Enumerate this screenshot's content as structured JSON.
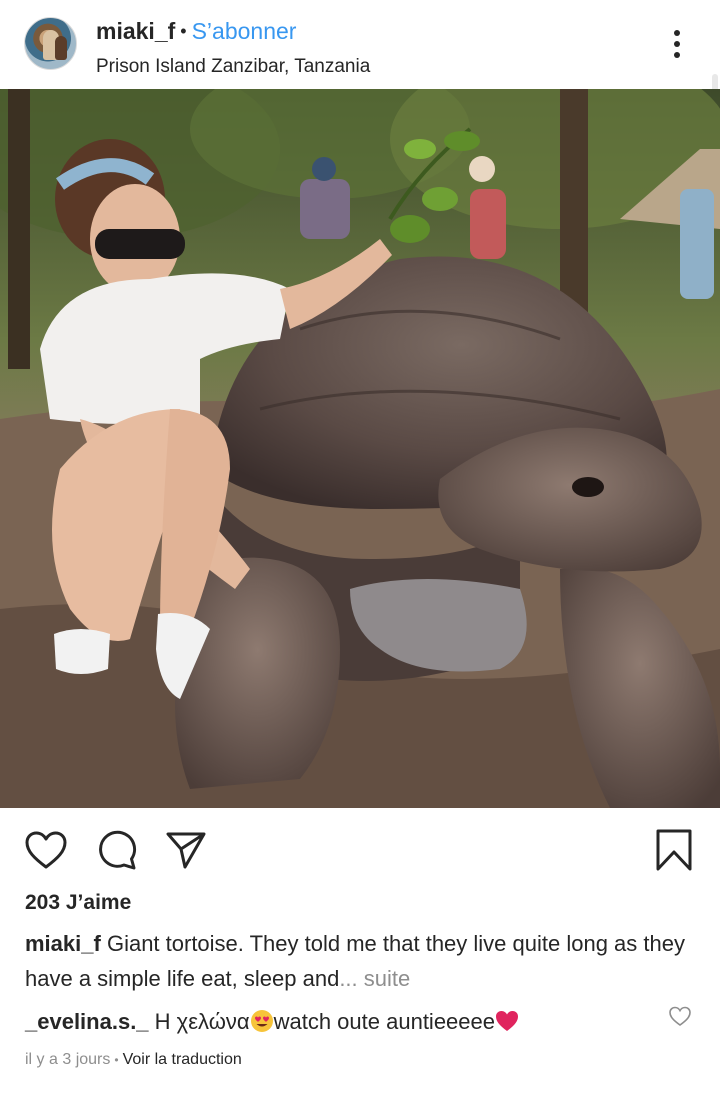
{
  "post": {
    "username": "miaki_f",
    "separator": "•",
    "follow_label": "S’abonner",
    "location": "Prison Island Zanzibar, Tanzania",
    "more_icon": "more-vertical-icon"
  },
  "actions": {
    "like_icon": "heart-outline-icon",
    "comment_icon": "comment-bubble-icon",
    "share_icon": "send-icon",
    "save_icon": "bookmark-icon"
  },
  "likes": "203 J’aime",
  "caption": {
    "username": "miaki_f",
    "text": "Giant tortoise. They told me that they live quite long as they have a simple life eat, sleep and",
    "ellipsis": "...",
    "more_label": "suite"
  },
  "comment": {
    "username": "_evelina.s._",
    "text_before_emoji": "Η χελώνα",
    "text_after_emoji": "watch oute auntieeeee",
    "emoji_1": "heart-eyes-emoji",
    "emoji_2": "red-heart-emoji"
  },
  "meta": {
    "time": "il y a 3 jours",
    "separator": "•",
    "translate_label": "Voir la traduction"
  },
  "colors": {
    "link_blue": "#3897f0",
    "text": "#262626",
    "muted": "#8e8e8e",
    "heart_red": "#e0245e"
  }
}
